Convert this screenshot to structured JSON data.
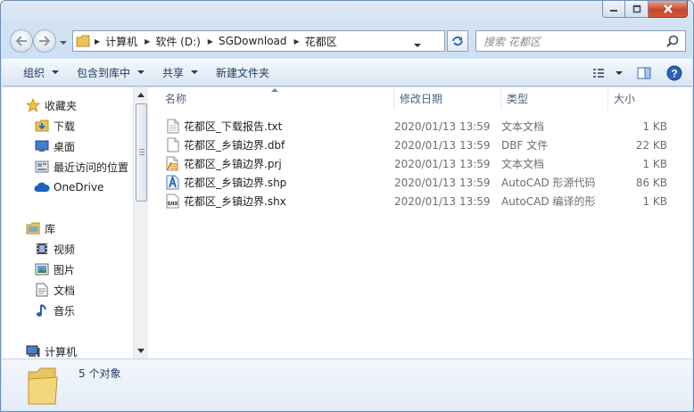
{
  "address": {
    "crumbs": [
      "计算机",
      "软件 (D:)",
      "SGDownload",
      "花都区"
    ]
  },
  "search": {
    "placeholder": "搜索 花都区"
  },
  "toolbar": {
    "organize": "组织",
    "include_in_library": "包含到库中",
    "share": "共享",
    "new_folder": "新建文件夹"
  },
  "nav": {
    "favorites": "收藏夹",
    "downloads": "下载",
    "desktop": "桌面",
    "recent": "最近访问的位置",
    "onedrive": "OneDrive",
    "libraries": "库",
    "videos": "视频",
    "pictures": "图片",
    "documents": "文档",
    "music": "音乐",
    "computer": "计算机"
  },
  "columns": {
    "name": "名称",
    "date": "修改日期",
    "type": "类型",
    "size": "大小"
  },
  "files": [
    {
      "name": "花都区_下载报告.txt",
      "date": "2020/01/13 13:59",
      "type": "文本文档",
      "size": "1 KB",
      "icon": "text-file-icon"
    },
    {
      "name": "花都区_乡镇边界.dbf",
      "date": "2020/01/13 13:59",
      "type": "DBF 文件",
      "size": "22 KB",
      "icon": "blank-file-icon"
    },
    {
      "name": "花都区_乡镇边界.prj",
      "date": "2020/01/13 13:59",
      "type": "文本文档",
      "size": "1 KB",
      "icon": "prj-file-icon"
    },
    {
      "name": "花都区_乡镇边界.shp",
      "date": "2020/01/13 13:59",
      "type": "AutoCAD 形源代码",
      "size": "86 KB",
      "icon": "autocad-shp-icon"
    },
    {
      "name": "花都区_乡镇边界.shx",
      "date": "2020/01/13 13:59",
      "type": "AutoCAD 编译的形",
      "size": "1 KB",
      "icon": "shx-file-icon"
    }
  ],
  "status": {
    "count": "5 个对象"
  }
}
